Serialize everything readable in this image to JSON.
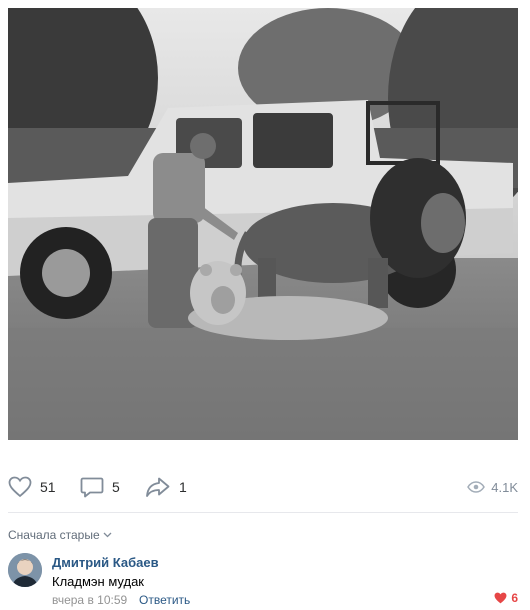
{
  "post": {
    "photo_icon": "photo-image",
    "likes": "51",
    "comments": "5",
    "shares": "1",
    "views": "4.1K"
  },
  "comments_section": {
    "sort_label": "Сначала старые"
  },
  "comment": {
    "author": "Дмитрий Кабаев",
    "text": "Кладмэн мудак",
    "time": "вчера в 10:59",
    "reply_label": "Ответить",
    "likes": "6"
  },
  "colors": {
    "link": "#2a5885",
    "icon": "#818c99",
    "like_active": "#e64646"
  }
}
